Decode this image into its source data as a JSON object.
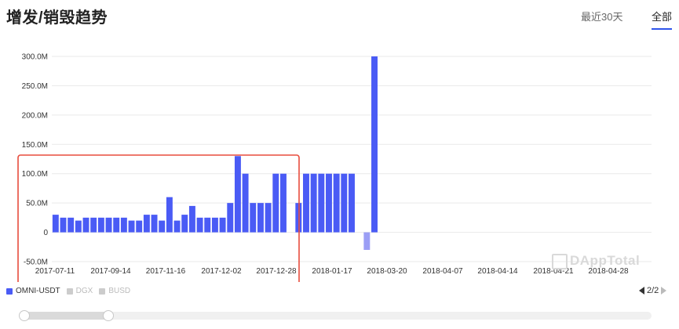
{
  "header": {
    "title": "增发/销毁趋势",
    "range_30d": "最近30天",
    "range_all": "全部"
  },
  "watermark": "DAppTotal",
  "legend": [
    {
      "label": "OMNI-USDT",
      "color": "#4a5bf5",
      "active": true
    },
    {
      "label": "DGX",
      "color": "#cccccc",
      "active": false
    },
    {
      "label": "BUSD",
      "color": "#cccccc",
      "active": false
    }
  ],
  "pager": {
    "text": "2/2"
  },
  "slider": {
    "start_fraction": 0.0,
    "end_fraction": 0.137
  },
  "colors": {
    "bar": "#4a5bf5",
    "bar_negative": "#9b9ef5",
    "highlight_box": "#e84c3d",
    "grid": "#e9e9e9"
  },
  "chart_data": {
    "type": "bar",
    "title": "",
    "xlabel": "",
    "ylabel": "",
    "ylim": [
      -50,
      300
    ],
    "y_ticks": [
      "300.0M",
      "250.0M",
      "200.0M",
      "150.0M",
      "100.0M",
      "50.0M",
      "0",
      "-50.0M"
    ],
    "y_tick_values": [
      300,
      250,
      200,
      150,
      100,
      50,
      0,
      -50
    ],
    "x_ticks": [
      "2017-07-11",
      "2017-09-14",
      "2017-11-16",
      "2017-12-02",
      "2017-12-28",
      "2018-01-17",
      "2018-03-20",
      "2018-04-07",
      "2018-04-14",
      "2018-04-21",
      "2018-04-28"
    ],
    "series": [
      {
        "name": "OMNI-USDT",
        "unit": "M",
        "values": [
          30,
          25,
          25,
          20,
          25,
          25,
          25,
          25,
          25,
          25,
          20,
          20,
          30,
          30,
          20,
          60,
          20,
          30,
          45,
          25,
          25,
          25,
          25,
          50,
          130,
          100,
          50,
          50,
          50,
          100,
          100,
          0,
          50,
          100,
          100,
          100,
          100,
          100,
          100,
          100,
          0,
          -30,
          300,
          0,
          0,
          0,
          0,
          0,
          0,
          0,
          0,
          0,
          0,
          0,
          0,
          0,
          0,
          0,
          0,
          0,
          0,
          0,
          0,
          0,
          0,
          0,
          0,
          0,
          0,
          0,
          0,
          0,
          0,
          0,
          0,
          0,
          0,
          0,
          0
        ]
      }
    ],
    "grid": true,
    "legend_position": "bottom-left"
  }
}
